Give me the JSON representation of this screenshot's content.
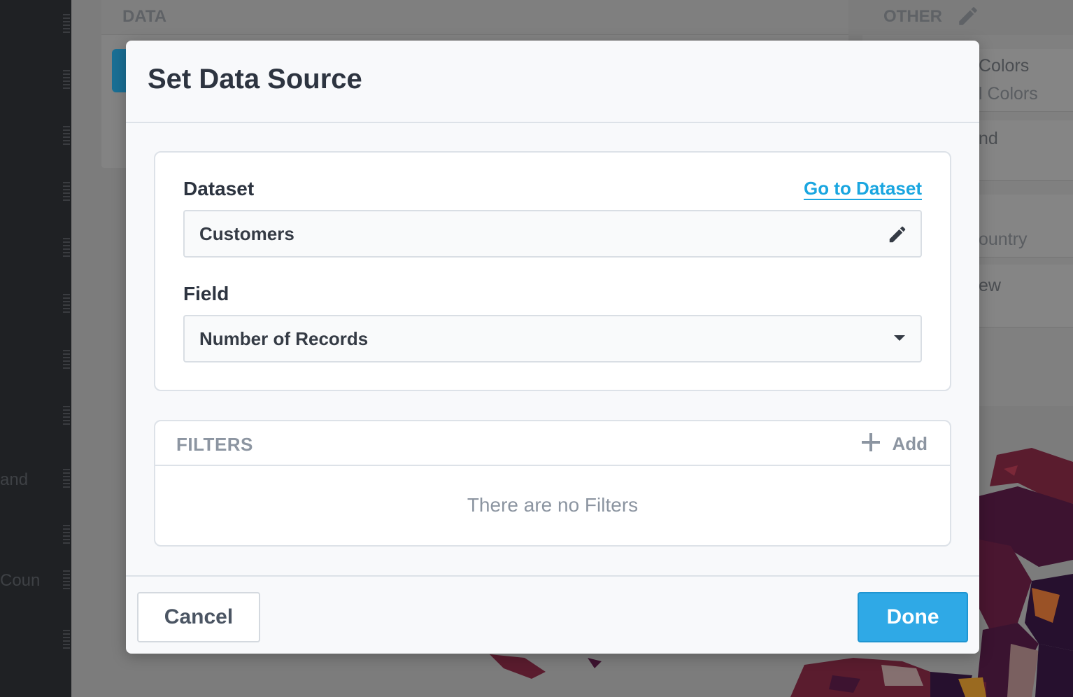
{
  "background": {
    "data_header": "DATA",
    "other_header": "OTHER",
    "other_items": [
      "Colors",
      "l Colors",
      "nd",
      "ountry",
      "ew"
    ],
    "left_items": [
      "and",
      "Coun"
    ]
  },
  "modal": {
    "title": "Set Data Source",
    "dataset": {
      "label": "Dataset",
      "link": "Go to Dataset",
      "value": "Customers"
    },
    "field": {
      "label": "Field",
      "value": "Number of Records"
    },
    "filters": {
      "title": "FILTERS",
      "add_label": "Add",
      "empty_message": "There are no Filters"
    },
    "footer": {
      "cancel_label": "Cancel",
      "done_label": "Done"
    }
  },
  "colors": {
    "accent": "#2fa9e6",
    "link": "#1aa6e0",
    "title": "#2d3440",
    "muted": "#8c95a1"
  },
  "icons": {
    "dataset_edit": "pencil-icon",
    "field_dropdown": "caret-down-icon",
    "add_filter": "plus-icon",
    "other_edit": "pencil-icon"
  }
}
